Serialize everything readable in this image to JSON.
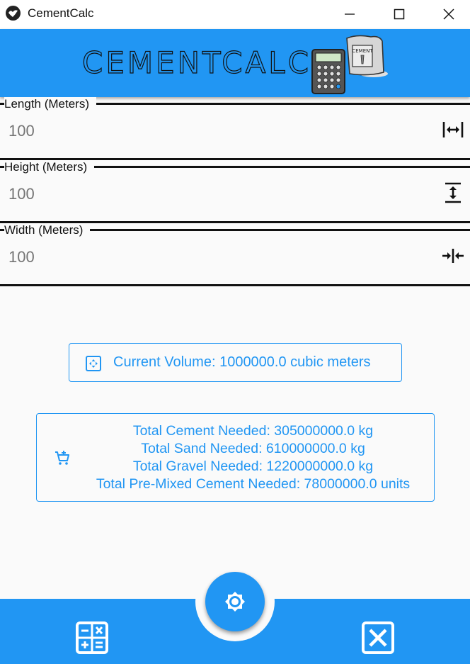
{
  "window": {
    "title": "CementCalc",
    "controls": [
      "minimize",
      "maximize",
      "close"
    ]
  },
  "header": {
    "logo_text": "CEMENTCALC",
    "bag_label": "CEMENT"
  },
  "fields": [
    {
      "label": "Length (Meters)",
      "value": "100",
      "icon": "horizontal-arrows-icon"
    },
    {
      "label": "Height (Meters)",
      "value": "100",
      "icon": "vertical-arrows-icon"
    },
    {
      "label": "Width (Meters)",
      "value": "100",
      "icon": "compress-arrows-icon"
    }
  ],
  "volume": {
    "text": "Current Volume: 1000000.0 cubic meters",
    "icon": "move-cube-icon"
  },
  "results": {
    "icon": "cart-plus-icon",
    "lines": [
      "Total Cement Needed: 305000000.0 kg",
      "Total Sand Needed: 610000000.0 kg",
      "Total Gravel Needed: 1220000000.0 kg",
      "Total Pre-Mixed Cement Needed: 78000000.0 units"
    ]
  },
  "bottom_bar": {
    "left_icon": "calculator-icon",
    "center_icon": "settings-icon",
    "right_icon": "close-box-icon"
  },
  "colors": {
    "primary": "#2196f3",
    "background": "#fafafa",
    "placeholder_text": "#9e9e9e"
  }
}
